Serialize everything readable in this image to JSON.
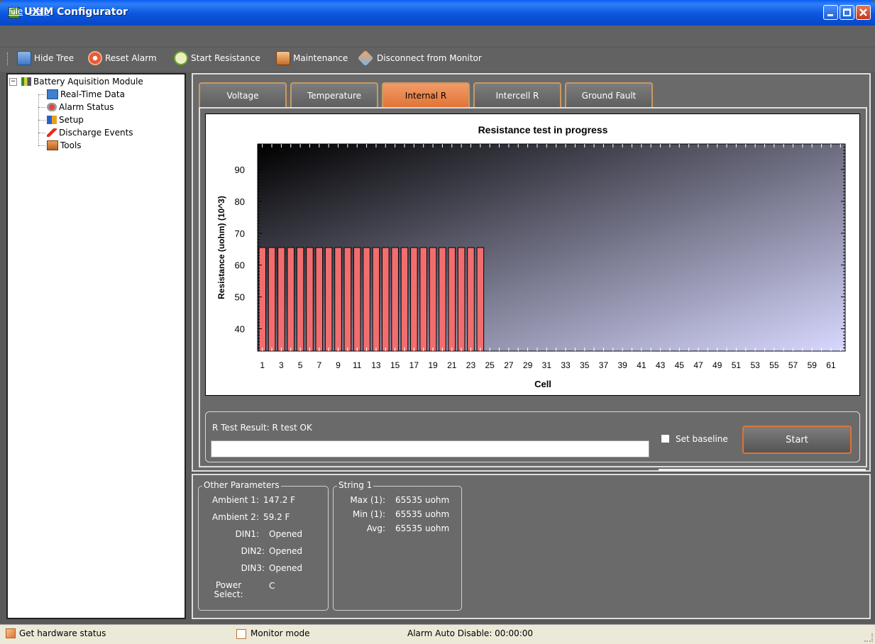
{
  "window": {
    "title": "UXIM Configurator",
    "icon_text": "ul"
  },
  "menu": {
    "file": "File",
    "help": "Help"
  },
  "toolbar": {
    "hide_tree": "Hide Tree",
    "reset_alarm": "Reset Alarm",
    "start_resistance": "Start Resistance",
    "maintenance": "Maintenance",
    "disconnect": "Disconnect from Monitor"
  },
  "tree": {
    "root": "Battery Aquisition Module",
    "items": [
      "Real-Time Data",
      "Alarm Status",
      "Setup",
      "Discharge Events",
      "Tools"
    ]
  },
  "tabs": [
    "Voltage",
    "Temperature",
    "Internal R",
    "Intercell R",
    "Ground Fault"
  ],
  "active_tab": "Internal R",
  "chart_data": {
    "type": "bar",
    "title": "Resistance test in progress",
    "xlabel": "Cell",
    "ylabel": "Resistance (uohm) (10^3)",
    "x_tick_labels": [
      "1",
      "3",
      "5",
      "7",
      "9",
      "11",
      "13",
      "15",
      "17",
      "19",
      "21",
      "23",
      "25",
      "27",
      "29",
      "31",
      "33",
      "35",
      "37",
      "39",
      "41",
      "43",
      "45",
      "47",
      "49",
      "51",
      "53",
      "55",
      "57",
      "59",
      "61"
    ],
    "y_tick_labels": [
      "40",
      "50",
      "60",
      "70",
      "80",
      "90"
    ],
    "ylim": [
      33,
      98
    ],
    "xlim": [
      0.5,
      62.5
    ],
    "categories": [
      1,
      2,
      3,
      4,
      5,
      6,
      7,
      8,
      9,
      10,
      11,
      12,
      13,
      14,
      15,
      16,
      17,
      18,
      19,
      20,
      21,
      22,
      23,
      24
    ],
    "values": [
      65.5,
      65.5,
      65.5,
      65.5,
      65.5,
      65.5,
      65.5,
      65.5,
      65.5,
      65.5,
      65.5,
      65.5,
      65.5,
      65.5,
      65.5,
      65.5,
      65.5,
      65.5,
      65.5,
      65.5,
      65.5,
      65.5,
      65.5,
      65.5
    ],
    "bar_color": "#f26e6e",
    "background_gradient": [
      "#000000",
      "#d8d8ff"
    ]
  },
  "result": {
    "label": "R Test Result: R test OK",
    "progress": 0,
    "set_baseline": "Set baseline",
    "set_baseline_checked": false,
    "start": "Start"
  },
  "other_params": {
    "legend": "Other Parameters",
    "rows": [
      {
        "label": "Ambient 1:",
        "value": "147.2 F"
      },
      {
        "label": "Ambient 2:",
        "value": "59.2 F"
      },
      {
        "label": "DIN1:",
        "value": "Opened"
      },
      {
        "label": "DIN2:",
        "value": "Opened"
      },
      {
        "label": "DIN3:",
        "value": "Opened"
      },
      {
        "label": "Power Select:",
        "label_line1": "Power",
        "label_line2": "Select:",
        "value": "C"
      }
    ]
  },
  "string1": {
    "legend": "String 1",
    "rows": [
      {
        "label": "Max (1):",
        "value": "65535 uohm"
      },
      {
        "label": "Min (1):",
        "value": "65535 uohm"
      },
      {
        "label": "Avg:",
        "value": "65535 uohm"
      }
    ]
  },
  "status": {
    "hardware": "Get hardware status",
    "mode": "Monitor mode",
    "alarm": "Alarm Auto Disable: 00:00:00"
  },
  "colors": {
    "accent": "#e07335",
    "titlebar": "#0b56dd",
    "panel": "#6a6a6a"
  }
}
